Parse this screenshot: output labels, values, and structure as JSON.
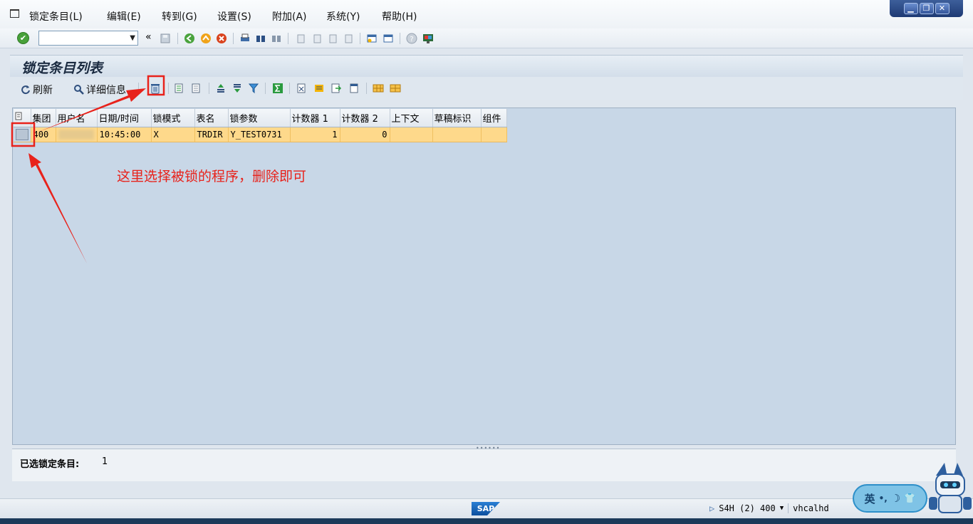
{
  "menu": {
    "items": [
      "锁定条目(L)",
      "编辑(E)",
      "转到(G)",
      "设置(S)",
      "附加(A)",
      "系统(Y)",
      "帮助(H)"
    ]
  },
  "window_controls": {
    "minimize": "▁",
    "restore": "❐",
    "close": "✕"
  },
  "toolbar": {
    "command_field_value": "",
    "back_double": "«"
  },
  "title": "锁定条目列表",
  "app_toolbar": {
    "refresh_label": "刷新",
    "details_label": "详细信息"
  },
  "grid": {
    "columns": [
      "",
      "集团",
      "用户名",
      "日期/时间",
      "锁模式",
      "表名",
      "锁参数",
      "计数器 1",
      "计数器 2",
      "上下文",
      "草稿标识",
      "组件"
    ],
    "rows": [
      {
        "client": "400",
        "user": "",
        "time": "10:45:00",
        "mode": "X",
        "table": "TRDIR",
        "arg": "Y_TEST0731",
        "counter1": "1",
        "counter2": "0",
        "context": "",
        "draft": "",
        "component": ""
      }
    ]
  },
  "annotation": {
    "text": "这里选择被锁的程序，删除即可",
    "color": "#e8221b"
  },
  "selection_panel": {
    "label": "已选锁定条目:",
    "value": "1"
  },
  "statusbar": {
    "logo": "SAP",
    "system": "S4H (2) 400",
    "host": "vhcalhd"
  },
  "ime": {
    "lang": "英"
  },
  "colors": {
    "row_highlight": "#fed98b",
    "grid_background": "#c8d7e7",
    "annotation": "#e8221b"
  }
}
